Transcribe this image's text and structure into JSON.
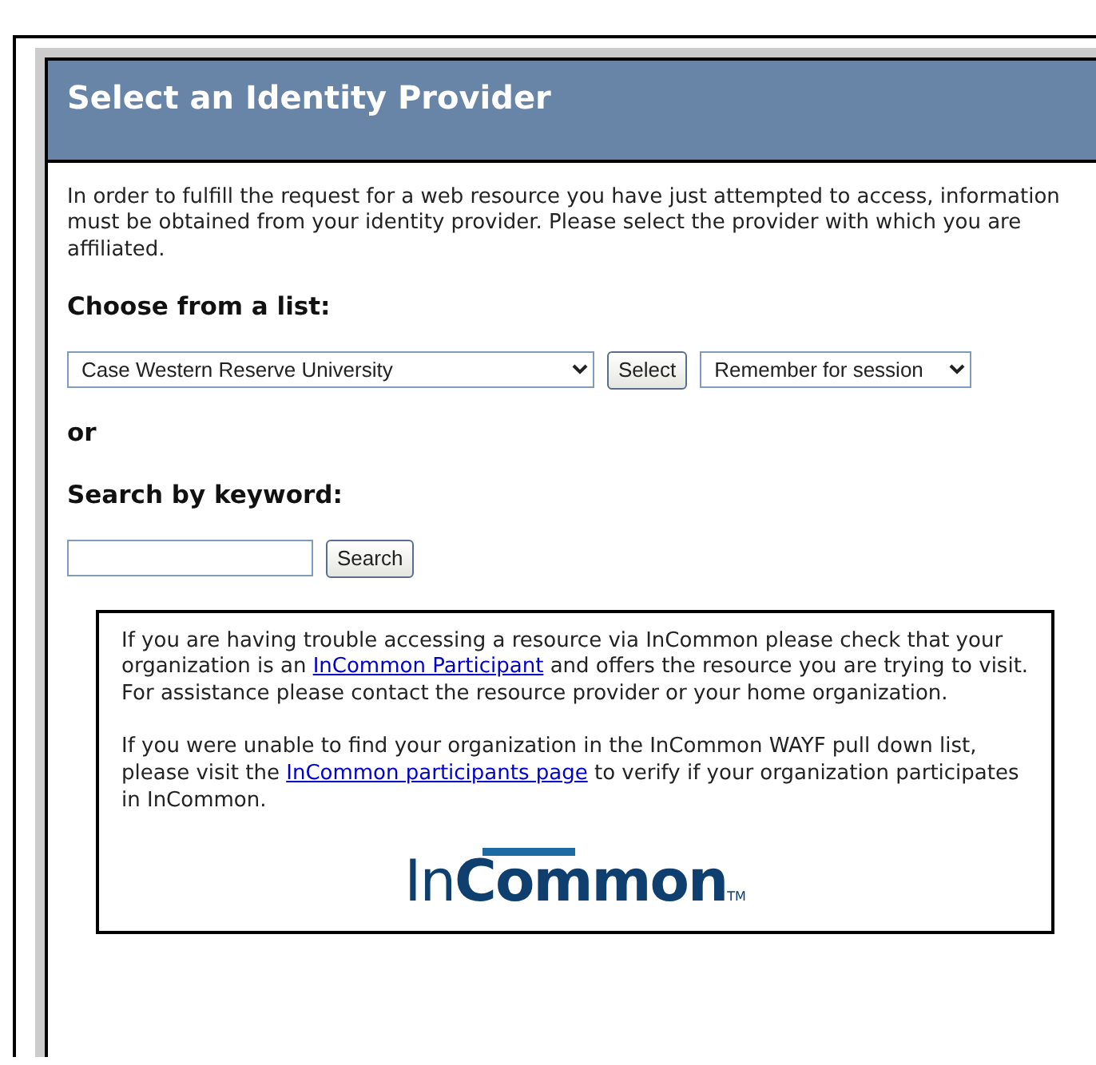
{
  "header": {
    "title": "Select an Identity Provider"
  },
  "intro": "In order to fulfill the request for a web resource you have just attempted to access, information must be obtained from your identity provider. Please select the provider with which you are affiliated.",
  "choose": {
    "heading": "Choose from a list:",
    "provider_value": "Case Western Reserve University",
    "button": "Select",
    "remember_value": "Remember for session"
  },
  "or_label": "or",
  "search": {
    "heading": "Search by keyword:",
    "button": "Search"
  },
  "help": {
    "paragraphs": [
      {
        "before": "If you are having trouble accessing a resource via InCommon please check that your organization is an ",
        "link": "InCommon Participant",
        "after": " and offers the resource you are trying to visit. For assistance please contact the resource provider or your home organization."
      },
      {
        "before": "If you were unable to find your organization in the InCommon WAYF pull down list, please visit the ",
        "link": "InCommon participants page",
        "after": " to verify if your organization participates in InCommon."
      }
    ],
    "logo": {
      "light": "In",
      "bold": "Common",
      "mark": "TM"
    }
  }
}
